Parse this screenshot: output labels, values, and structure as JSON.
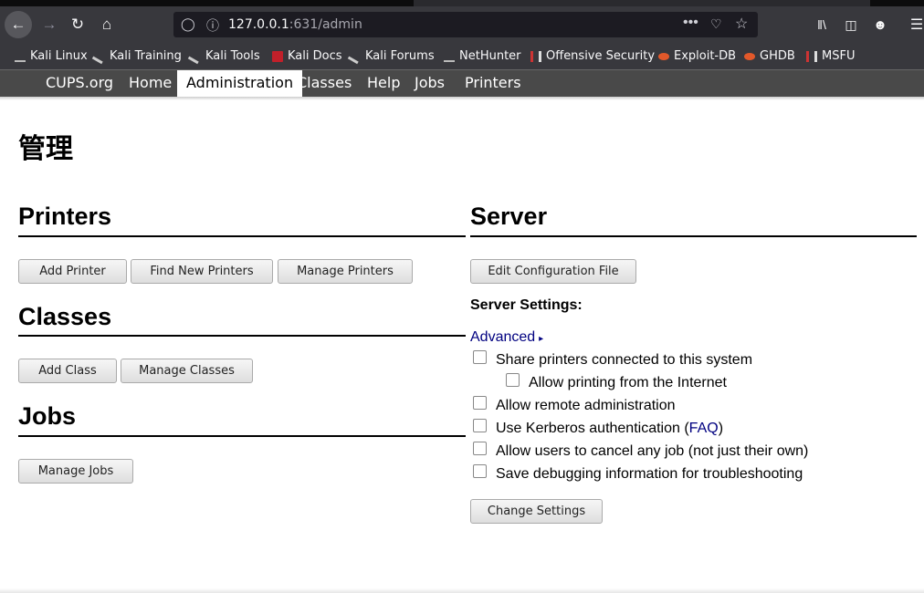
{
  "browser": {
    "url_host": "127.0.0.1",
    "url_path": ":631/admin",
    "bookmarks": [
      "Kali Linux",
      "Kali Training",
      "Kali Tools",
      "Kali Docs",
      "Kali Forums",
      "NetHunter",
      "Offensive Security",
      "Exploit-DB",
      "GHDB",
      "MSFU"
    ],
    "icons": {
      "back": "back-arrow-icon",
      "forward": "forward-arrow-icon",
      "reload": "reload-icon",
      "home": "home-icon",
      "more": "more-dots-icon",
      "pocket": "pocket-icon",
      "star": "star-icon",
      "library": "library-icon",
      "sidebar": "sidebar-icon",
      "account": "account-icon",
      "menu": "hamburger-menu-icon"
    }
  },
  "cups_nav": [
    "CUPS.org",
    "Home",
    "Administration",
    "Classes",
    "Help",
    "Jobs",
    "Printers"
  ],
  "cups_nav_active": "Administration",
  "page": {
    "title": "管理",
    "printers": {
      "heading": "Printers",
      "buttons": [
        "Add Printer",
        "Find New Printers",
        "Manage Printers"
      ]
    },
    "classes": {
      "heading": "Classes",
      "buttons": [
        "Add Class",
        "Manage Classes"
      ]
    },
    "jobs": {
      "heading": "Jobs",
      "buttons": [
        "Manage Jobs"
      ]
    },
    "server": {
      "heading": "Server",
      "edit_config": "Edit Configuration File",
      "settings_label": "Server Settings:",
      "advanced": "Advanced",
      "options": [
        "Share printers connected to this system",
        "Allow printing from the Internet",
        "Allow remote administration",
        "Use Kerberos authentication (",
        "Allow users to cancel any job (not just their own)",
        "Save debugging information for troubleshooting"
      ],
      "faq_link": "FAQ",
      "faq_close": ")",
      "change_settings": "Change Settings"
    }
  },
  "colors": {
    "link": "#000080",
    "nav_bg": "#494949",
    "chrome": "#38383d"
  }
}
